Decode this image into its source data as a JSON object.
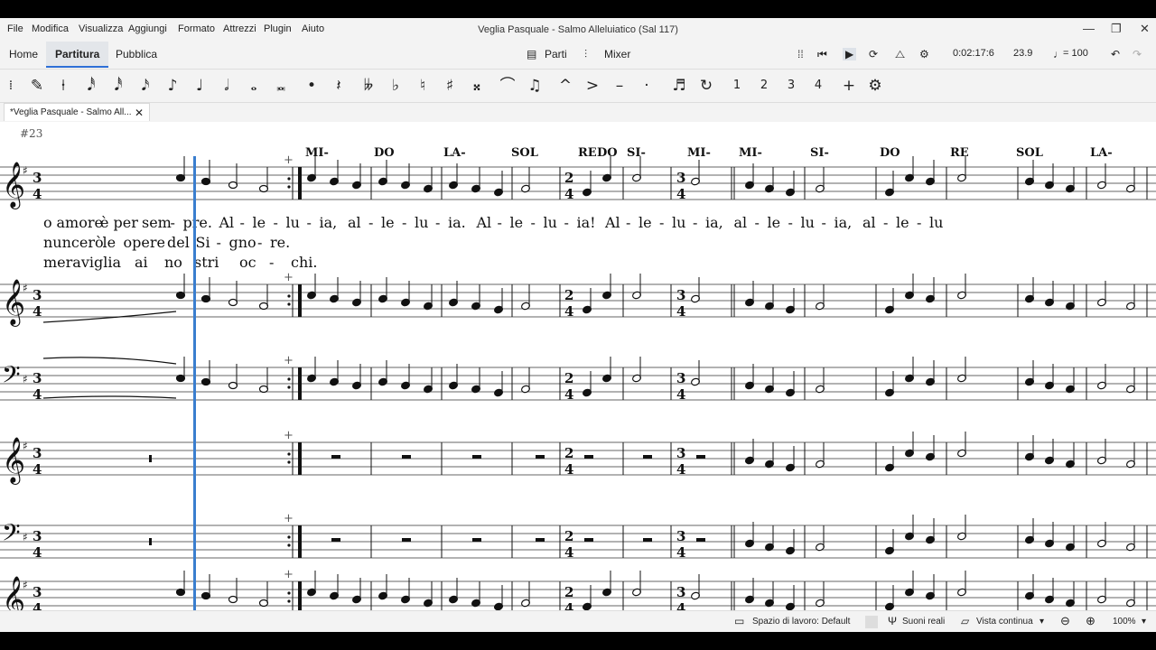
{
  "menu": [
    "File",
    "Modifica",
    "Visualizza",
    "Aggiungi",
    "Formato",
    "Attrezzi",
    "Plugin",
    "Aiuto"
  ],
  "window_title": "Veglia Pasquale - Salmo Alleluiatico (Sal 117)",
  "window_controls": {
    "minimize": "—",
    "maximize": "❐",
    "close": "✕"
  },
  "tabs": [
    "Home",
    "Partitura",
    "Pubblica"
  ],
  "active_tab": "Partitura",
  "toolbar": {
    "parts_label": "Parti",
    "mixer_label": "Mixer",
    "time": "0:02:17:6",
    "position": "23.9",
    "tempo": "= 100"
  },
  "icons": [
    "drag-handle-icon",
    "rewind-icon",
    "play-icon",
    "loop-icon",
    "metronome-icon",
    "playback-settings-icon",
    "undo-icon",
    "redo-icon",
    "pencil-icon",
    "pin-icon",
    "plus-icon",
    "gear-icon"
  ],
  "palette": [
    "𝅘𝅥𝅰",
    "𝅘𝅥𝅰",
    "𝅘𝅥𝅯",
    "♪",
    "♩",
    "𝅗𝅥",
    "𝅝",
    "𝅜",
    "•",
    "𝄽",
    "𝄫",
    "♭",
    "♮",
    "♯",
    "𝄪",
    "⌒",
    "♫",
    "^",
    ">",
    "–",
    "·",
    "♬",
    "↻",
    "1",
    "2",
    "3",
    "4",
    "+",
    "⚙"
  ],
  "document_tab": "*Veglia Pasquale - Salmo All...",
  "document_tab_close": "✕",
  "score": {
    "measure_number": "#23",
    "chord_labels": [
      "MI-",
      "DO",
      "LA-",
      "SOL",
      "RE",
      "DO",
      "SI-",
      "MI-",
      "MI-",
      "SI-",
      "DO",
      "RE",
      "SOL",
      "LA-"
    ],
    "lyrics_line1": [
      "o",
      "amore",
      "è",
      "per",
      "sem",
      "-",
      "pre.",
      "Al",
      "-",
      "le",
      "-",
      "lu",
      "-",
      "ia,",
      "al",
      "-",
      "le",
      "-",
      "lu",
      "-",
      "ia.",
      "Al",
      "-",
      "le",
      "-",
      "lu",
      "-",
      "ia!",
      "Al",
      "-",
      "le",
      "-",
      "lu",
      "-",
      "ia,",
      "al",
      "-",
      "le",
      "-",
      "lu",
      "-",
      "ia,",
      "al",
      "-",
      "le",
      "-",
      "lu"
    ],
    "lyrics_line2": [
      "nuncerò",
      "le",
      "opere",
      "del",
      "Si",
      "-",
      "gno",
      "-",
      "re."
    ],
    "lyrics_line3": [
      "meraviglia",
      "ai",
      "no",
      "stri",
      "oc",
      "-",
      "chi."
    ],
    "time_signatures": [
      "3/4",
      "2/4",
      "3/4"
    ]
  },
  "status": {
    "workspace": "Spazio di lavoro: Default",
    "concert_pitch": "Suoni reali",
    "view_mode": "Vista continua",
    "zoom": "100%"
  }
}
